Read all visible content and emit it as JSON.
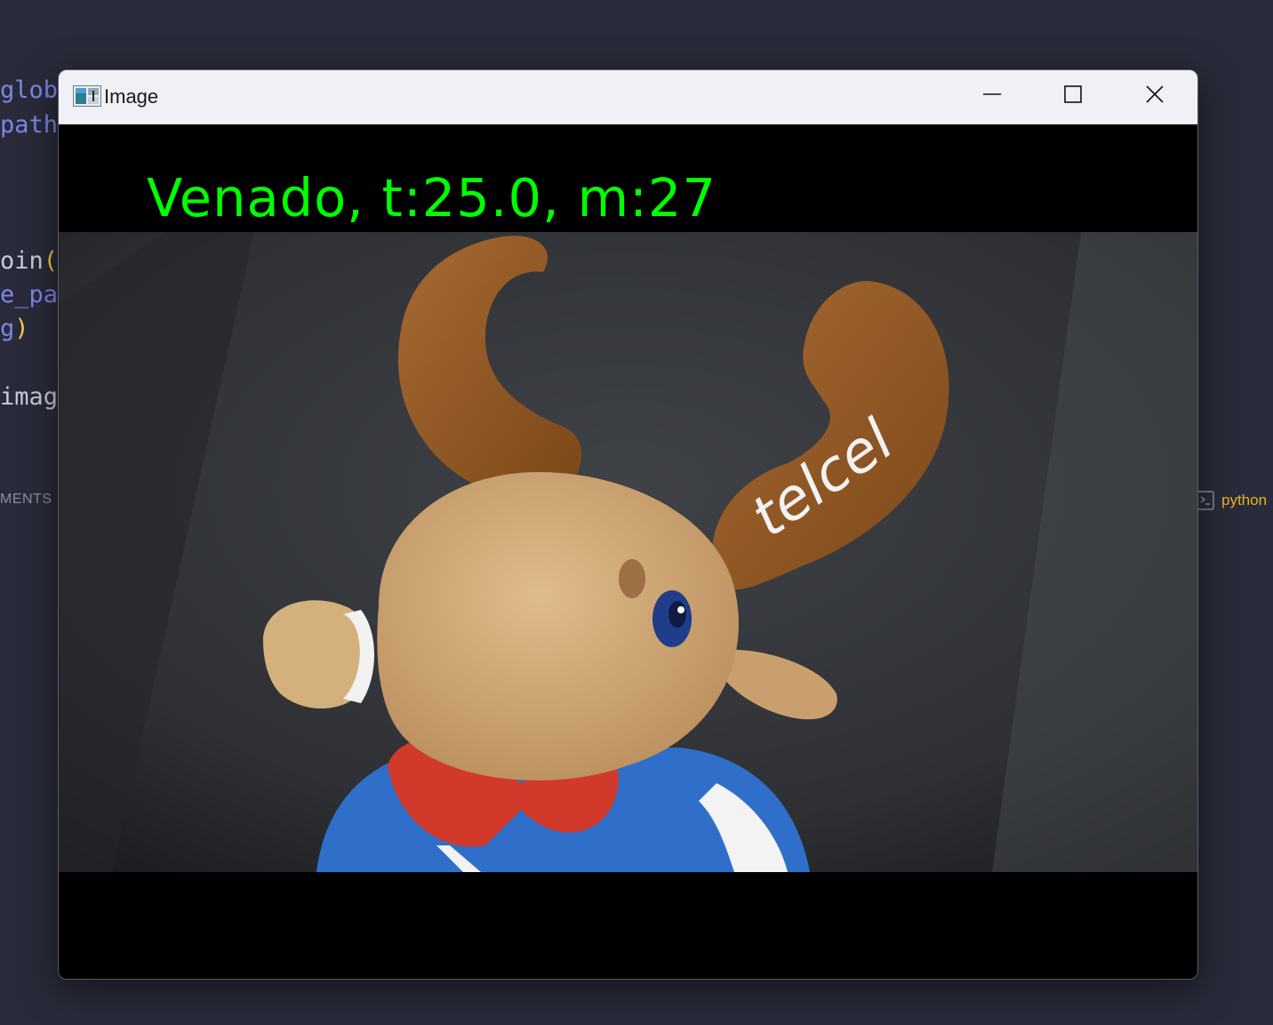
{
  "editor": {
    "lines": [
      {
        "text": "glob",
        "kind": "var"
      },
      {
        "text": "path",
        "kind": "var"
      },
      {
        "text": "oin(",
        "kind": "plain"
      },
      {
        "text": "e_pat",
        "kind": "var"
      },
      {
        "text": "g)",
        "kind": "var"
      },
      {
        "text": "image",
        "kind": "plain"
      }
    ],
    "panel_label": "MENTS",
    "terminal_label": "python"
  },
  "window": {
    "title": "Image",
    "controls": {
      "minimize_icon": "minimize-icon",
      "maximize_icon": "maximize-icon",
      "close_icon": "close-icon"
    }
  },
  "image": {
    "overlay_text": "Venado, t:25.0, m:27",
    "overlay_color": "#00ff00",
    "embroidered_text": "telcel"
  },
  "colors": {
    "editor_bg": "#292b3a",
    "titlebar_bg": "#f0f1f6",
    "terminal_accent": "#e6b422"
  }
}
